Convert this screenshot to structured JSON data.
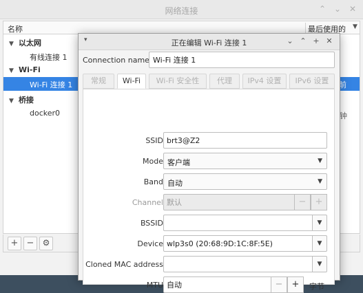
{
  "bg_window": {
    "title": "网络连接",
    "controls": {
      "min": "⌃",
      "max": "⌄",
      "close": "✕"
    },
    "columns": {
      "name": "名称",
      "last_used": "最后使用的"
    },
    "groups": [
      {
        "label": "以太网",
        "items": [
          "有线连接 1"
        ]
      },
      {
        "label": "Wi-Fi",
        "items": [
          "Wi-Fi 连接 1"
        ]
      },
      {
        "label": "桥接",
        "items": [
          "docker0"
        ]
      }
    ],
    "selected_right_text": "前",
    "right_fragment": "钟",
    "toolbar": {
      "add": "+",
      "remove": "−",
      "settings": "⚙"
    }
  },
  "dialog": {
    "title": "正在编辑 Wi-Fi 连接 1",
    "menu": "▾",
    "controls": {
      "down": "⌄",
      "up": "⌃",
      "add": "+",
      "close": "✕"
    },
    "connection_name_label": "Connection name",
    "connection_name_value": "Wi-Fi 连接 1",
    "tabs": [
      "常规",
      "Wi-Fi",
      "Wi-Fi 安全性",
      "代理",
      "IPv4 设置",
      "IPv6 设置"
    ],
    "active_tab": "Wi-Fi",
    "fields": {
      "ssid": {
        "label": "SSID",
        "value": "brt3@Z2"
      },
      "mode": {
        "label": "Mode",
        "value": "客户端"
      },
      "band": {
        "label": "Band",
        "value": "自动"
      },
      "channel": {
        "label": "Channel",
        "value": "默认",
        "minus": "−",
        "plus": "+"
      },
      "bssid": {
        "label": "BSSID",
        "value": ""
      },
      "device": {
        "label": "Device",
        "value": "wlp3s0 (20:68:9D:1C:8F:5E)"
      },
      "cloned_mac": {
        "label": "Cloned MAC address",
        "value": ""
      },
      "mtu": {
        "label": "MTU",
        "value": "自动",
        "minus": "−",
        "plus": "+",
        "unit": "字节"
      }
    }
  }
}
